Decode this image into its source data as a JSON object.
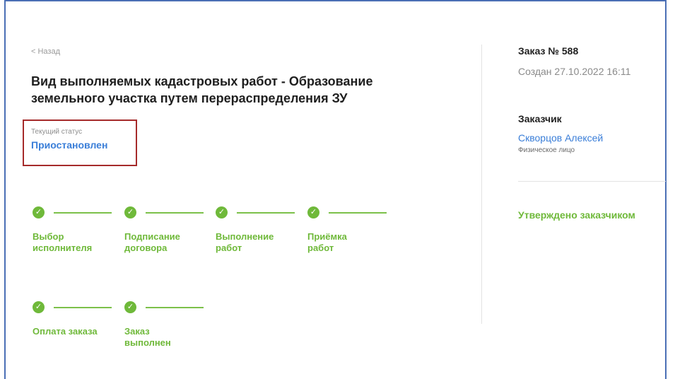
{
  "nav": {
    "back_label": "< Назад"
  },
  "work": {
    "title_line1": "Вид выполняемых кадастровых работ - Образование",
    "title_line2": "земельного участка путем перераспределения ЗУ"
  },
  "status": {
    "label": "Текущий статус",
    "value": "Приостановлен"
  },
  "steps": [
    {
      "line1": "Выбор",
      "line2": "исполнителя",
      "icon": "check-icon"
    },
    {
      "line1": "Подписание",
      "line2": "договора",
      "icon": "check-icon"
    },
    {
      "line1": "Выполнение",
      "line2": "работ",
      "icon": "check-icon"
    },
    {
      "line1": "Приёмка",
      "line2": "работ",
      "icon": "check-icon"
    },
    {
      "line1": "Оплата заказа",
      "line2": "",
      "icon": "check-icon"
    },
    {
      "line1": "Заказ",
      "line2": "выполнен",
      "icon": "check-icon"
    }
  ],
  "order": {
    "number": "Заказ № 588",
    "created": "Создан 27.10.2022 16:11"
  },
  "customer": {
    "title": "Заказчик",
    "name": "Скворцов Алексей",
    "type": "Физическое лицо"
  },
  "approval": {
    "text": "Утверждено заказчиком"
  },
  "colors": {
    "accent_green": "#6fb93a",
    "link_blue": "#3a7ed8",
    "highlight_red": "#a52a2a",
    "frame_blue": "#4a6fb5"
  }
}
